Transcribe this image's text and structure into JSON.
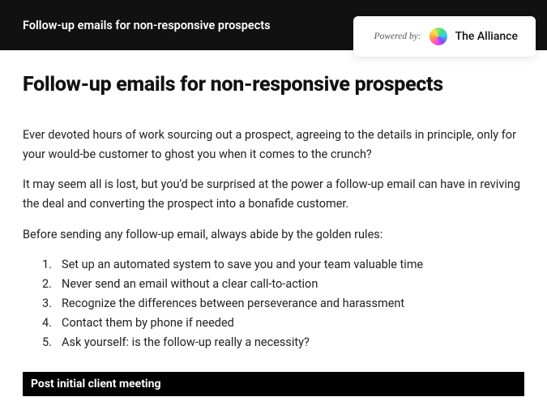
{
  "header": {
    "title": "Follow-up emails for non-responsive prospects"
  },
  "badge": {
    "powered_by": "Powered by:",
    "brand": "The Alliance"
  },
  "main": {
    "heading": "Follow-up emails for non-responsive prospects",
    "paragraphs": [
      "Ever devoted hours of work sourcing out a prospect, agreeing to the details in principle, only for your would-be customer to ghost you when it comes to the crunch?",
      "It may seem all is lost, but you'd be surprised at the power a follow-up email can have in reviving the deal and converting the prospect into a bonafide customer.",
      "Before sending any follow-up email, always abide by the golden rules:"
    ],
    "rules": [
      "Set up an automated system to save you and your team valuable time",
      "Never send an email without a clear call-to-action",
      "Recognize the differences between perseverance and harassment",
      "Contact them by phone if needed",
      "Ask yourself: is the follow-up really a necessity?"
    ],
    "section_title": "Post initial client meeting"
  }
}
